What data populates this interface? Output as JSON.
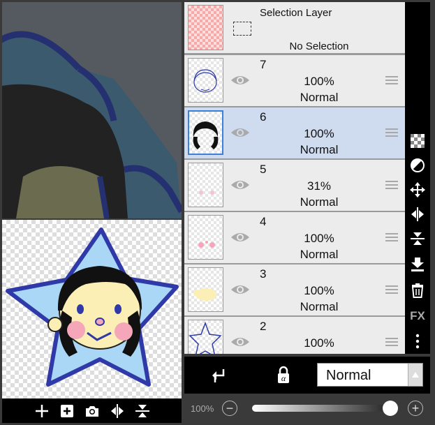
{
  "colors": {
    "accent": "#3b7fd8",
    "selected_layer_bg": "#cfdcef",
    "panel_bg": "#ececec",
    "toolbar_bg": "#000000"
  },
  "preview_toolbar": {
    "icons": [
      "add-icon",
      "add-layer-icon",
      "camera-icon",
      "flip-horizontal-icon",
      "flip-vertical-icon"
    ]
  },
  "selection_layer": {
    "title": "Selection Layer",
    "status": "No Selection"
  },
  "layers": [
    {
      "number": "7",
      "opacity": "100%",
      "mode": "Normal",
      "selected": false
    },
    {
      "number": "6",
      "opacity": "100%",
      "mode": "Normal",
      "selected": true
    },
    {
      "number": "5",
      "opacity": "31%",
      "mode": "Normal",
      "selected": false
    },
    {
      "number": "4",
      "opacity": "100%",
      "mode": "Normal",
      "selected": false
    },
    {
      "number": "3",
      "opacity": "100%",
      "mode": "Normal",
      "selected": false
    },
    {
      "number": "2",
      "opacity": "100%",
      "mode": "",
      "selected": false
    }
  ],
  "tools": [
    "checker-icon",
    "mask-icon",
    "move-icon",
    "flip-h-icon",
    "flip-v-icon",
    "merge-down-icon",
    "trash-icon",
    "fx-icon",
    "more-icon"
  ],
  "fx_label": "FX",
  "blend": {
    "mode": "Normal"
  },
  "opacity": {
    "label": "100%",
    "value": 0.99
  }
}
